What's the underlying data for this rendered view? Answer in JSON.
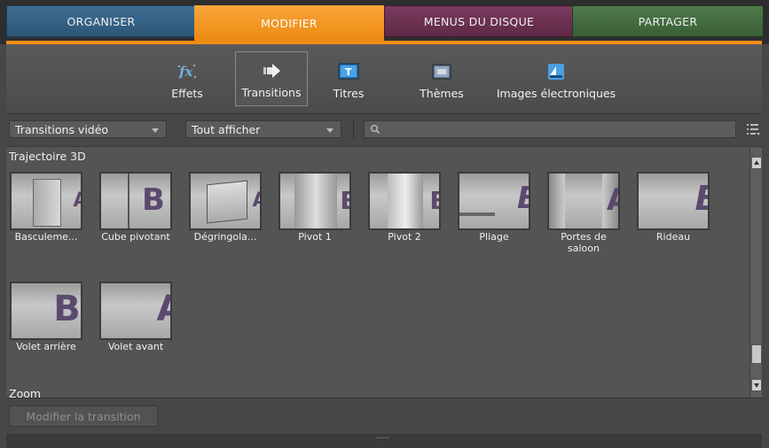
{
  "tabs": [
    {
      "label": "ORGANISER"
    },
    {
      "label": "MODIFIER"
    },
    {
      "label": "MENUS DU DISQUE"
    },
    {
      "label": "PARTAGER"
    }
  ],
  "toolbar": {
    "effets": "Effets",
    "transitions": "Transitions",
    "titres": "Titres",
    "themes": "Thèmes",
    "images": "Images électroniques"
  },
  "filters": {
    "category": "Transitions vidéo",
    "show": "Tout afficher"
  },
  "section": {
    "title": "Trajectoire 3D",
    "items": [
      {
        "caption": "Basculeme...",
        "glyph": "A"
      },
      {
        "caption": "Cube pivotant",
        "glyph": "B A"
      },
      {
        "caption": "Dégringola...",
        "glyph": "A"
      },
      {
        "caption": "Pivot 1",
        "glyph": "B"
      },
      {
        "caption": "Pivot 2",
        "glyph": "B"
      },
      {
        "caption": "Pliage",
        "glyph": "B"
      },
      {
        "caption": "Portes de saloon",
        "glyph": "A"
      },
      {
        "caption": "Rideau",
        "glyph": "B"
      },
      {
        "caption": "Volet arrière",
        "glyph": "BA"
      },
      {
        "caption": "Volet avant",
        "glyph": "A"
      }
    ]
  },
  "next_section": "Zoom",
  "bottom": {
    "apply_label": "Modifier la transition"
  },
  "colors": {
    "organiser": "#3f6e94",
    "modifier": "#f39a25",
    "menus": "#6d3352",
    "partager": "#46703f"
  }
}
